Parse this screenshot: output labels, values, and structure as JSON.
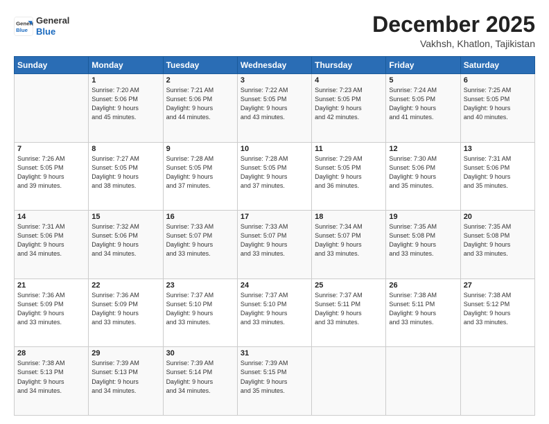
{
  "header": {
    "logo": {
      "line1": "General",
      "line2": "Blue"
    },
    "title": "December 2025",
    "location": "Vakhsh, Khatlon, Tajikistan"
  },
  "calendar": {
    "days_of_week": [
      "Sunday",
      "Monday",
      "Tuesday",
      "Wednesday",
      "Thursday",
      "Friday",
      "Saturday"
    ],
    "weeks": [
      [
        {
          "num": "",
          "detail": ""
        },
        {
          "num": "1",
          "detail": "Sunrise: 7:20 AM\nSunset: 5:06 PM\nDaylight: 9 hours\nand 45 minutes."
        },
        {
          "num": "2",
          "detail": "Sunrise: 7:21 AM\nSunset: 5:06 PM\nDaylight: 9 hours\nand 44 minutes."
        },
        {
          "num": "3",
          "detail": "Sunrise: 7:22 AM\nSunset: 5:05 PM\nDaylight: 9 hours\nand 43 minutes."
        },
        {
          "num": "4",
          "detail": "Sunrise: 7:23 AM\nSunset: 5:05 PM\nDaylight: 9 hours\nand 42 minutes."
        },
        {
          "num": "5",
          "detail": "Sunrise: 7:24 AM\nSunset: 5:05 PM\nDaylight: 9 hours\nand 41 minutes."
        },
        {
          "num": "6",
          "detail": "Sunrise: 7:25 AM\nSunset: 5:05 PM\nDaylight: 9 hours\nand 40 minutes."
        }
      ],
      [
        {
          "num": "7",
          "detail": "Sunrise: 7:26 AM\nSunset: 5:05 PM\nDaylight: 9 hours\nand 39 minutes."
        },
        {
          "num": "8",
          "detail": "Sunrise: 7:27 AM\nSunset: 5:05 PM\nDaylight: 9 hours\nand 38 minutes."
        },
        {
          "num": "9",
          "detail": "Sunrise: 7:28 AM\nSunset: 5:05 PM\nDaylight: 9 hours\nand 37 minutes."
        },
        {
          "num": "10",
          "detail": "Sunrise: 7:28 AM\nSunset: 5:05 PM\nDaylight: 9 hours\nand 37 minutes."
        },
        {
          "num": "11",
          "detail": "Sunrise: 7:29 AM\nSunset: 5:05 PM\nDaylight: 9 hours\nand 36 minutes."
        },
        {
          "num": "12",
          "detail": "Sunrise: 7:30 AM\nSunset: 5:06 PM\nDaylight: 9 hours\nand 35 minutes."
        },
        {
          "num": "13",
          "detail": "Sunrise: 7:31 AM\nSunset: 5:06 PM\nDaylight: 9 hours\nand 35 minutes."
        }
      ],
      [
        {
          "num": "14",
          "detail": "Sunrise: 7:31 AM\nSunset: 5:06 PM\nDaylight: 9 hours\nand 34 minutes."
        },
        {
          "num": "15",
          "detail": "Sunrise: 7:32 AM\nSunset: 5:06 PM\nDaylight: 9 hours\nand 34 minutes."
        },
        {
          "num": "16",
          "detail": "Sunrise: 7:33 AM\nSunset: 5:07 PM\nDaylight: 9 hours\nand 33 minutes."
        },
        {
          "num": "17",
          "detail": "Sunrise: 7:33 AM\nSunset: 5:07 PM\nDaylight: 9 hours\nand 33 minutes."
        },
        {
          "num": "18",
          "detail": "Sunrise: 7:34 AM\nSunset: 5:07 PM\nDaylight: 9 hours\nand 33 minutes."
        },
        {
          "num": "19",
          "detail": "Sunrise: 7:35 AM\nSunset: 5:08 PM\nDaylight: 9 hours\nand 33 minutes."
        },
        {
          "num": "20",
          "detail": "Sunrise: 7:35 AM\nSunset: 5:08 PM\nDaylight: 9 hours\nand 33 minutes."
        }
      ],
      [
        {
          "num": "21",
          "detail": "Sunrise: 7:36 AM\nSunset: 5:09 PM\nDaylight: 9 hours\nand 33 minutes."
        },
        {
          "num": "22",
          "detail": "Sunrise: 7:36 AM\nSunset: 5:09 PM\nDaylight: 9 hours\nand 33 minutes."
        },
        {
          "num": "23",
          "detail": "Sunrise: 7:37 AM\nSunset: 5:10 PM\nDaylight: 9 hours\nand 33 minutes."
        },
        {
          "num": "24",
          "detail": "Sunrise: 7:37 AM\nSunset: 5:10 PM\nDaylight: 9 hours\nand 33 minutes."
        },
        {
          "num": "25",
          "detail": "Sunrise: 7:37 AM\nSunset: 5:11 PM\nDaylight: 9 hours\nand 33 minutes."
        },
        {
          "num": "26",
          "detail": "Sunrise: 7:38 AM\nSunset: 5:11 PM\nDaylight: 9 hours\nand 33 minutes."
        },
        {
          "num": "27",
          "detail": "Sunrise: 7:38 AM\nSunset: 5:12 PM\nDaylight: 9 hours\nand 33 minutes."
        }
      ],
      [
        {
          "num": "28",
          "detail": "Sunrise: 7:38 AM\nSunset: 5:13 PM\nDaylight: 9 hours\nand 34 minutes."
        },
        {
          "num": "29",
          "detail": "Sunrise: 7:39 AM\nSunset: 5:13 PM\nDaylight: 9 hours\nand 34 minutes."
        },
        {
          "num": "30",
          "detail": "Sunrise: 7:39 AM\nSunset: 5:14 PM\nDaylight: 9 hours\nand 34 minutes."
        },
        {
          "num": "31",
          "detail": "Sunrise: 7:39 AM\nSunset: 5:15 PM\nDaylight: 9 hours\nand 35 minutes."
        },
        {
          "num": "",
          "detail": ""
        },
        {
          "num": "",
          "detail": ""
        },
        {
          "num": "",
          "detail": ""
        }
      ]
    ]
  }
}
